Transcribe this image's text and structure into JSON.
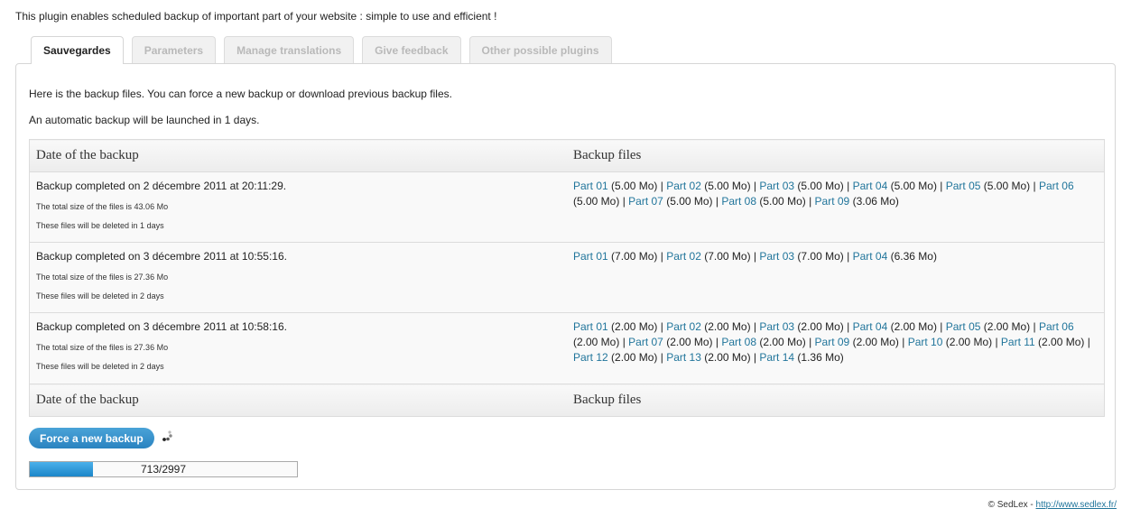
{
  "intro": "This plugin enables scheduled backup of important part of your website : simple to use and efficient !",
  "tabs": [
    {
      "label": "Sauvegardes",
      "active": true
    },
    {
      "label": "Parameters",
      "active": false
    },
    {
      "label": "Manage translations",
      "active": false
    },
    {
      "label": "Give feedback",
      "active": false
    },
    {
      "label": "Other possible plugins",
      "active": false
    }
  ],
  "panel": {
    "info1": "Here is the backup files. You can force a new backup or download previous backup files.",
    "info2": "An automatic backup will be launched in 1 days."
  },
  "table": {
    "headers": [
      "Date of the backup",
      "Backup files"
    ],
    "rows": [
      {
        "completed": "Backup completed on 2 décembre 2011 at 20:11:29.",
        "size": "The total size of the files is 43.06 Mo",
        "deleted": "These files will be deleted in 1 days",
        "parts": [
          {
            "label": "Part 01",
            "size": "(5.00 Mo)"
          },
          {
            "label": "Part 02",
            "size": "(5.00 Mo)"
          },
          {
            "label": "Part 03",
            "size": "(5.00 Mo)"
          },
          {
            "label": "Part 04",
            "size": "(5.00 Mo)"
          },
          {
            "label": "Part 05",
            "size": "(5.00 Mo)"
          },
          {
            "label": "Part 06",
            "size": "(5.00 Mo)"
          },
          {
            "label": "Part 07",
            "size": "(5.00 Mo)"
          },
          {
            "label": "Part 08",
            "size": "(5.00 Mo)"
          },
          {
            "label": "Part 09",
            "size": "(3.06 Mo)"
          }
        ]
      },
      {
        "completed": "Backup completed on 3 décembre 2011 at 10:55:16.",
        "size": "The total size of the files is 27.36 Mo",
        "deleted": "These files will be deleted in 2 days",
        "parts": [
          {
            "label": "Part 01",
            "size": "(7.00 Mo)"
          },
          {
            "label": "Part 02",
            "size": "(7.00 Mo)"
          },
          {
            "label": "Part 03",
            "size": "(7.00 Mo)"
          },
          {
            "label": "Part 04",
            "size": "(6.36 Mo)"
          }
        ]
      },
      {
        "completed": "Backup completed on 3 décembre 2011 at 10:58:16.",
        "size": "The total size of the files is 27.36 Mo",
        "deleted": "These files will be deleted in 2 days",
        "parts": [
          {
            "label": "Part 01",
            "size": "(2.00 Mo)"
          },
          {
            "label": "Part 02",
            "size": "(2.00 Mo)"
          },
          {
            "label": "Part 03",
            "size": "(2.00 Mo)"
          },
          {
            "label": "Part 04",
            "size": "(2.00 Mo)"
          },
          {
            "label": "Part 05",
            "size": "(2.00 Mo)"
          },
          {
            "label": "Part 06",
            "size": "(2.00 Mo)"
          },
          {
            "label": "Part 07",
            "size": "(2.00 Mo)"
          },
          {
            "label": "Part 08",
            "size": "(2.00 Mo)"
          },
          {
            "label": "Part 09",
            "size": "(2.00 Mo)"
          },
          {
            "label": "Part 10",
            "size": "(2.00 Mo)"
          },
          {
            "label": "Part 11",
            "size": "(2.00 Mo)"
          },
          {
            "label": "Part 12",
            "size": "(2.00 Mo)"
          },
          {
            "label": "Part 13",
            "size": "(2.00 Mo)"
          },
          {
            "label": "Part 14",
            "size": "(1.36 Mo)"
          }
        ]
      }
    ]
  },
  "actions": {
    "force_label": "Force a new backup",
    "spinner_icon": "loading-spinner-icon"
  },
  "progress": {
    "current": 713,
    "total": 2997,
    "label": "713/2997"
  },
  "footer": {
    "copyright": "© SedLex - ",
    "link": "http://www.sedlex.fr/"
  },
  "colors": {
    "link": "#21759b",
    "button": "#2a83c0",
    "progress": "#1c86c9"
  }
}
